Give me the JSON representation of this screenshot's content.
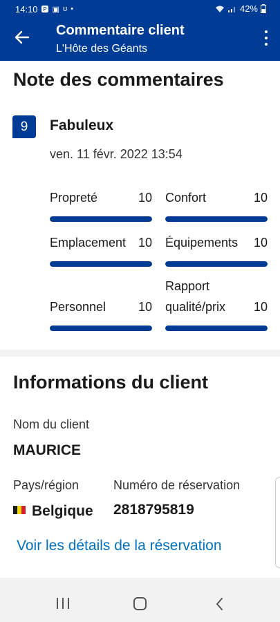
{
  "status_bar": {
    "time": "14:10",
    "left_icons": [
      "P",
      "gallery-icon",
      "notification-icon",
      "•"
    ],
    "battery": "42%"
  },
  "app_bar": {
    "title": "Commentaire client",
    "subtitle": "L'Hôte des Géants"
  },
  "review": {
    "heading": "Note des commentaires",
    "score": "9",
    "verdict": "Fabuleux",
    "date": "ven. 11 févr. 2022 13:54",
    "max_score": 10,
    "categories": [
      {
        "label": "Propreté",
        "value": "10",
        "score": 10
      },
      {
        "label": "Confort",
        "value": "10",
        "score": 10
      },
      {
        "label": "Emplacement",
        "value": "10",
        "score": 10
      },
      {
        "label": "Équipements",
        "value": "10",
        "score": 10
      },
      {
        "label_line1": "Personnel",
        "value": "10",
        "score": 10
      },
      {
        "label_line1": "Rapport",
        "label_line2": "qualité/prix",
        "value": "10",
        "score": 10
      }
    ]
  },
  "client": {
    "heading": "Informations du client",
    "name_label": "Nom du client",
    "name_value": "MAURICE",
    "country_label": "Pays/région",
    "country_value": "Belgique",
    "booking_label": "Numéro de réservation",
    "booking_value": "2818795819",
    "details_link": "Voir les détails de la réservation"
  },
  "colors": {
    "brand": "#003b95",
    "link": "#0071c2"
  }
}
